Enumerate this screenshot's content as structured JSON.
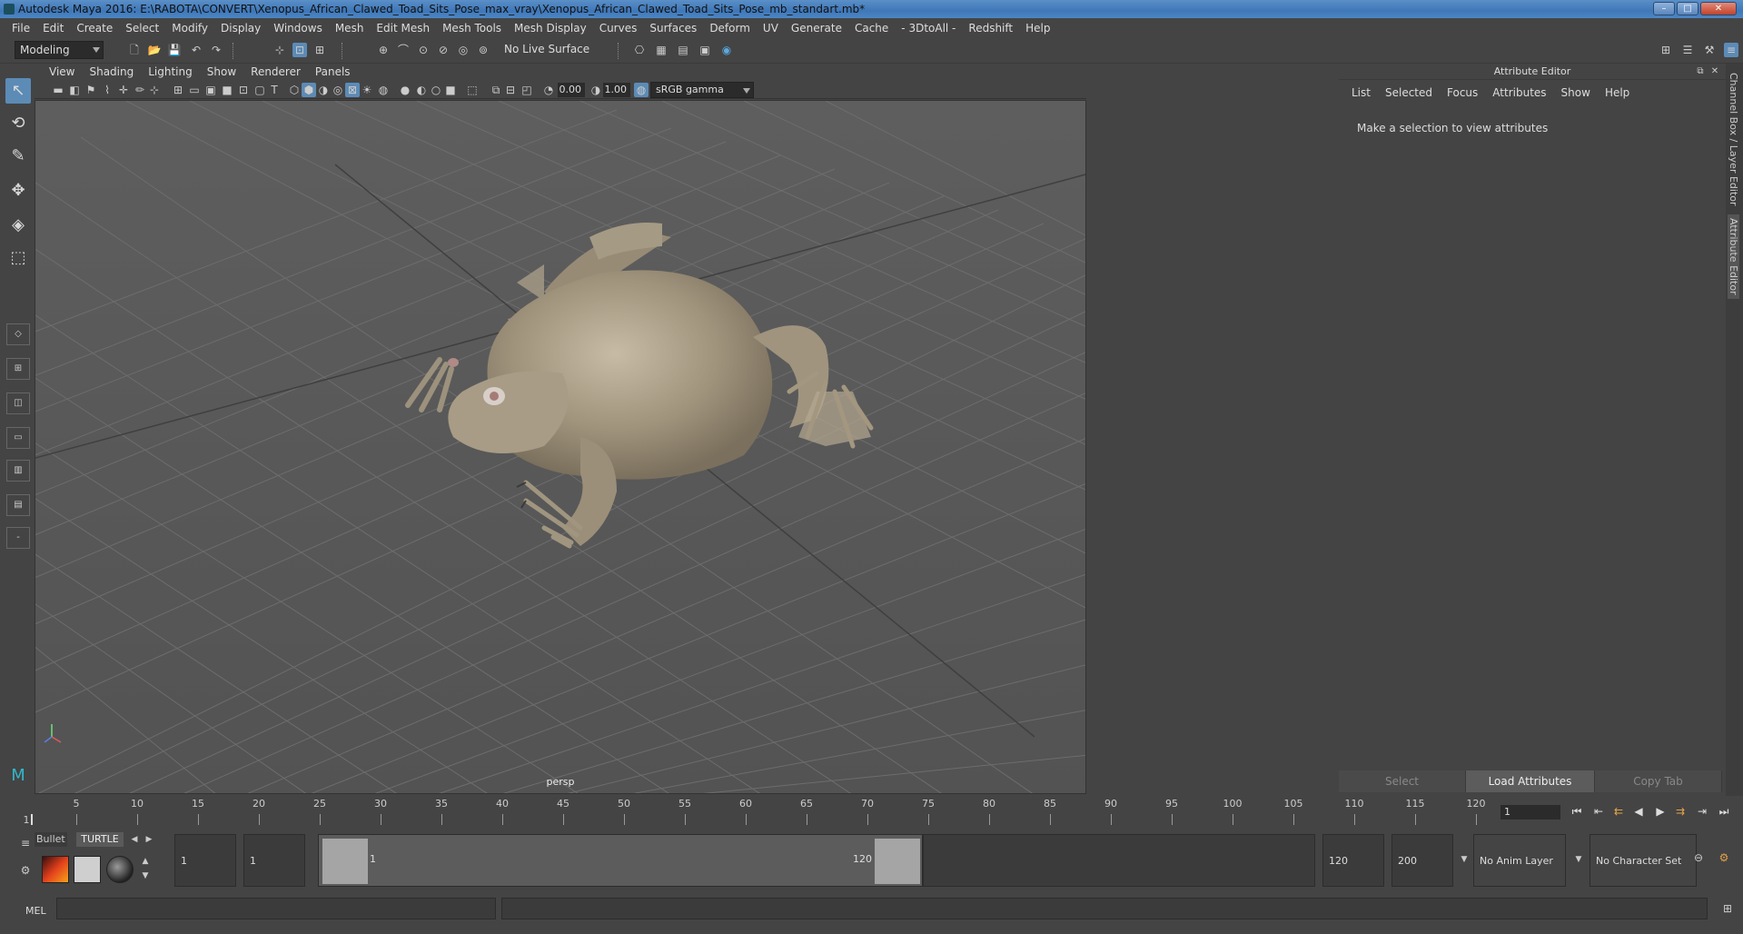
{
  "title": "Autodesk Maya 2016: E:\\RABOTA\\CONVERT\\Xenopus_African_Clawed_Toad_Sits_Pose_max_vray\\Xenopus_African_Clawed_Toad_Sits_Pose_mb_standart.mb*",
  "menu": [
    "File",
    "Edit",
    "Create",
    "Select",
    "Modify",
    "Display",
    "Windows",
    "Mesh",
    "Edit Mesh",
    "Mesh Tools",
    "Mesh Display",
    "Curves",
    "Surfaces",
    "Deform",
    "UV",
    "Generate",
    "Cache",
    "- 3DtoAll -",
    "Redshift",
    "Help"
  ],
  "mode": "Modeling",
  "live_surface": "No Live Surface",
  "viewport_menu": [
    "View",
    "Shading",
    "Lighting",
    "Show",
    "Renderer",
    "Panels"
  ],
  "exposure": "0.00",
  "gamma": "1.00",
  "color_space": "sRGB gamma",
  "camera": "persp",
  "attr": {
    "title": "Attribute Editor",
    "menu": [
      "List",
      "Selected",
      "Focus",
      "Attributes",
      "Show",
      "Help"
    ],
    "message": "Make a selection to view attributes",
    "buttons": [
      "Select",
      "Load Attributes",
      "Copy Tab"
    ]
  },
  "side_tabs": {
    "channel": "Channel Box / Layer Editor",
    "attr": "Attribute Editor"
  },
  "timeline": {
    "ticks": [
      "5",
      "10",
      "15",
      "20",
      "25",
      "30",
      "35",
      "40",
      "45",
      "50",
      "55",
      "60",
      "65",
      "70",
      "75",
      "80",
      "85",
      "90",
      "95",
      "100",
      "105",
      "110",
      "115",
      "120"
    ],
    "start_label": "1",
    "current_frame": "1"
  },
  "shelf": {
    "tab1": "Bullet",
    "tab2": "TURTLE"
  },
  "range": {
    "start": "1",
    "playback_start": "1",
    "slider_start": "1",
    "slider_end": "120",
    "playback_end": "120",
    "end": "200",
    "anim_layer": "No Anim Layer",
    "char_set": "No Character Set"
  },
  "mel": "MEL",
  "icons": [
    "select-arrow-icon",
    "lasso-icon",
    "paint-icon",
    "move-icon",
    "rotate-icon",
    "scale-icon"
  ]
}
